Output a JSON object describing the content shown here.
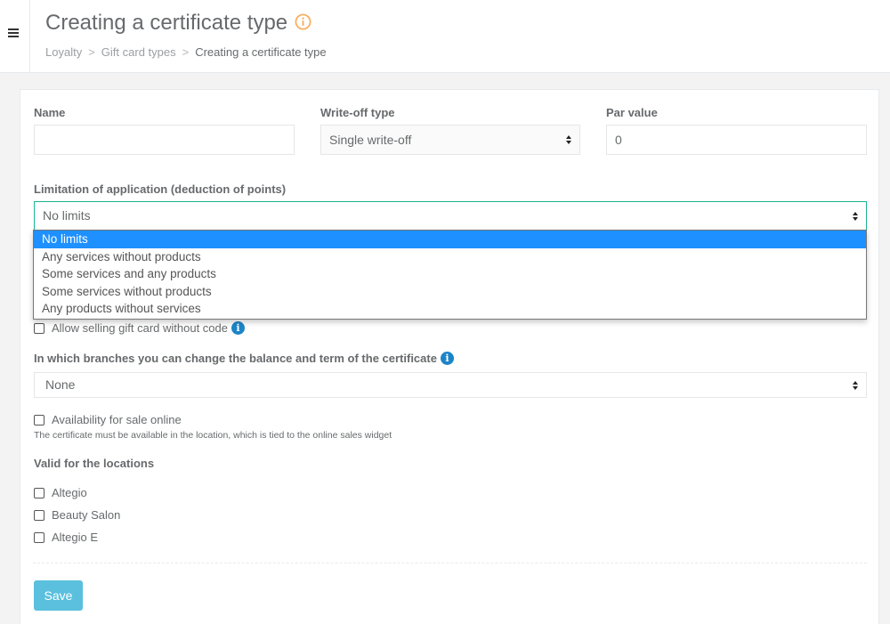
{
  "page": {
    "title": "Creating a certificate type",
    "title_icon": "info-circle-icon",
    "accent": "#f8ac59"
  },
  "breadcrumb": [
    "Loyalty",
    "Gift card types",
    "Creating a certificate type"
  ],
  "form": {
    "name": {
      "label": "Name",
      "value": ""
    },
    "writeoff": {
      "label": "Write-off type",
      "value": "Single write-off"
    },
    "par": {
      "label": "Par value",
      "value": "0"
    },
    "limitation": {
      "label": "Limitation of application (deduction of points)",
      "value": "No limits",
      "options": [
        "No limits",
        "Any services without products",
        "Some services and any products",
        "Some services without products",
        "Any products without services"
      ],
      "selected_index": 0,
      "highlight": "#1e90ff"
    },
    "allow_selling": {
      "label": "Allow selling gift card without code",
      "checked": false
    },
    "branches": {
      "label": "In which branches you can change the balance and term of the certificate",
      "value": "None"
    },
    "online": {
      "label": "Availability for sale online",
      "checked": false,
      "hint": "The certificate must be available in the location, which is tied to the online sales widget"
    },
    "locations": {
      "label": "Valid for the locations",
      "items": [
        "Altegio",
        "Beauty Salon",
        "Altegio E"
      ]
    },
    "save_label": "Save",
    "save_color": "#5bc0de"
  }
}
